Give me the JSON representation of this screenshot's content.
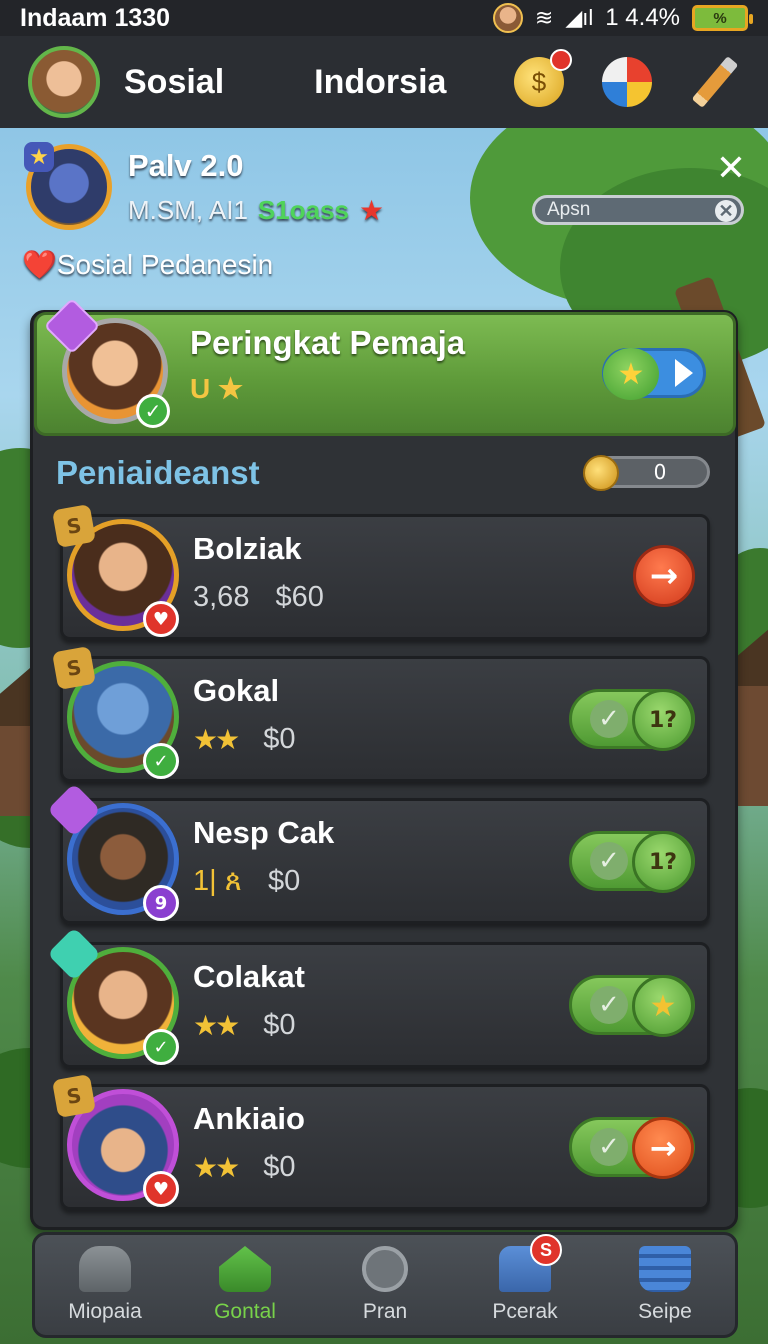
{
  "status_bar": {
    "left_text": "Indaam 1330",
    "percent_text": "1 4.4%",
    "battery_text": "%"
  },
  "header": {
    "title": "Sosial",
    "region": "Indorsia",
    "icons": [
      "coin-icon",
      "ball-icon",
      "pencil-icon"
    ]
  },
  "profile": {
    "name": "Palv 2.0",
    "meta": "M.SM, AI1",
    "class_label": "S1oass",
    "search_placeholder": "Apsn",
    "subtitle": "❤️Sosial Pedanesin"
  },
  "rank": {
    "title": "Peringkat Pemaja",
    "sub_prefix": "U"
  },
  "section": {
    "title": "Peniaideanst",
    "counter": "0"
  },
  "rows": [
    {
      "name": "Bolziak",
      "stat": "3,68",
      "cost": "$60",
      "action": "arrow",
      "badge_top": "S",
      "badge_bottom": "♥"
    },
    {
      "name": "Gokal",
      "stars": "★★",
      "cost": "$0",
      "action": "toggle",
      "knob": "1?",
      "badge_top": "S",
      "badge_bottom": "✓"
    },
    {
      "name": "Nesp Cak",
      "stat": "1| ጰ",
      "cost": "$0",
      "action": "toggle",
      "knob": "1?",
      "badge_top": "",
      "badge_bottom": "9"
    },
    {
      "name": "Colakat",
      "stars": "★★",
      "cost": "$0",
      "action": "toggle",
      "knob": "★",
      "badge_top": "",
      "badge_bottom": "✓"
    },
    {
      "name": "Ankiaio",
      "stars": "★★",
      "cost": "$0",
      "action": "toggle-orange",
      "knob": "→",
      "badge_top": "S",
      "badge_bottom": "♥"
    }
  ],
  "bottom_nav": [
    {
      "label": "Miopaia",
      "icon": "dinosaur-icon"
    },
    {
      "label": "Gontal",
      "icon": "home-icon",
      "active": true
    },
    {
      "label": "Pran",
      "icon": "timer-icon"
    },
    {
      "label": "Pcerak",
      "icon": "mailbox-icon",
      "badge": "S"
    },
    {
      "label": "Seipe",
      "icon": "bucket-icon"
    }
  ],
  "colors": {
    "accent_green": "#5f9b3a",
    "accent_blue": "#7ec3e6",
    "danger": "#d23a1c",
    "panel": "#2f3236"
  }
}
